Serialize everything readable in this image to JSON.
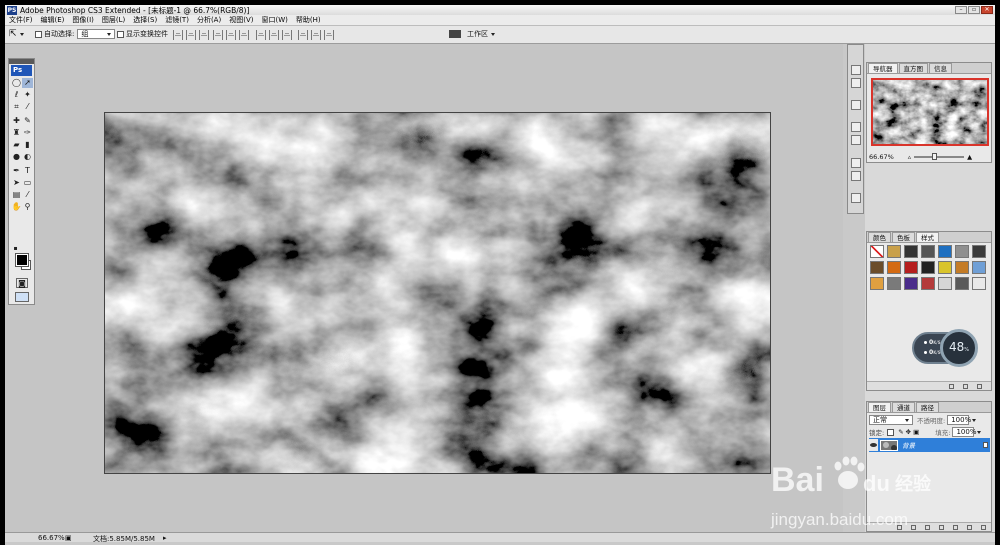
{
  "app": {
    "title": "Adobe Photoshop CS3 Extended - [未标题-1 @ 66.7%(RGB/8)]",
    "icon_label": "PS"
  },
  "menu": [
    "文件(F)",
    "编辑(E)",
    "图像(I)",
    "图层(L)",
    "选择(S)",
    "滤镜(T)",
    "分析(A)",
    "视图(V)",
    "窗口(W)",
    "帮助(H)"
  ],
  "options": {
    "auto_select_label": "自动选择:",
    "auto_select_value": "组",
    "show_transform_label": "显示变换控件",
    "workspace_label": "工作区"
  },
  "toolbox": {
    "logo": "Ps"
  },
  "canvas": {
    "fill": "clouds-filter-grayscale"
  },
  "status": {
    "zoom": "66.67%",
    "doc_size": "文档:5.85M/5.85M"
  },
  "navigator": {
    "tabs": [
      "导航器",
      "直方图",
      "信息"
    ],
    "active_tab": "导航器",
    "zoom": "66.67%",
    "zoom_slider_level": 0.4
  },
  "styles": {
    "tabs": [
      "颜色",
      "色板",
      "样式"
    ],
    "active_tab": "样式",
    "swatches": [
      "#ffffff",
      "#c9a04a",
      "#333333",
      "#555555",
      "#1e6fc0",
      "#8f8f8f",
      "#3a3a3a",
      "#6b4d2a",
      "#d46a12",
      "#b51e1e",
      "#222222",
      "#d9c42b",
      "#c47c27",
      "#6f9fd6",
      "#e0a040",
      "#7a7a7a",
      "#4a2c8a",
      "#b43a3a",
      "#d6d6d6",
      "#5a5a5a",
      "#e9e9e9"
    ]
  },
  "gauge": {
    "value": "48",
    "unit": "%",
    "row1_value": "0",
    "row1_unit": "K/S",
    "row2_value": "0",
    "row2_unit": "K/S"
  },
  "layers": {
    "tabs": [
      "图层",
      "通道",
      "路径"
    ],
    "active_tab": "图层",
    "blend_mode": "正常",
    "opacity_label": "不透明度:",
    "opacity_value": "100%",
    "lock_label": "锁定:",
    "fill_label": "填充:",
    "fill_value": "100%",
    "items": [
      {
        "name": "背景",
        "selected": true
      }
    ]
  },
  "watermark": {
    "brand": "Baidu经验",
    "url": "jingyan.baidu.com"
  },
  "colors": {
    "selection_blue": "#2f7fd9",
    "nav_frame_red": "#d9342b",
    "ps_blue": "#1f56b8"
  }
}
